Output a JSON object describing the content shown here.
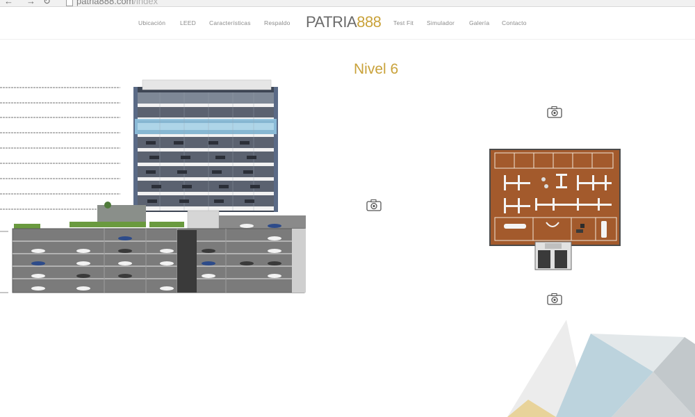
{
  "browser": {
    "url_domain": "patria888.com",
    "url_path": "/index"
  },
  "nav": {
    "left_items": [
      "Ubicación",
      "LEED",
      "Características",
      "Respaldo"
    ],
    "right_items": [
      "Test Fit",
      "Simulador",
      "Galería",
      "Contacto"
    ]
  },
  "logo": {
    "word": "PATRIA",
    "number": "888"
  },
  "level": {
    "title": "Nivel 6"
  },
  "colors": {
    "accent_gold": "#c9a23a",
    "nav_text": "#8a8a8a",
    "floor_wood": "#a35a2c",
    "glass_highlight": "#8fc3e0"
  },
  "icons": [
    "camera-icon",
    "camera-icon",
    "camera-icon"
  ]
}
